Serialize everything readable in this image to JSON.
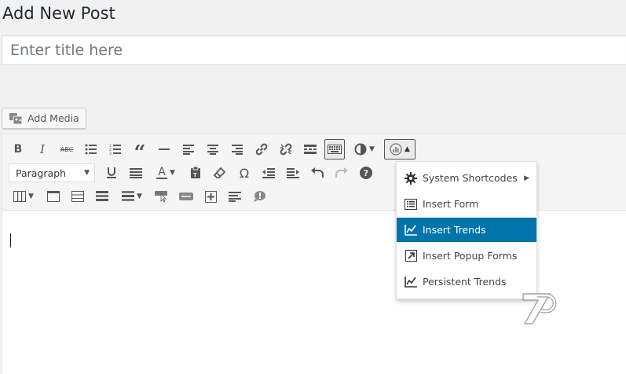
{
  "page": {
    "title": "Add New Post"
  },
  "title_field": {
    "placeholder": "Enter title here",
    "value": ""
  },
  "media": {
    "add_label": "Add Media"
  },
  "toolbar": {
    "row1": [
      {
        "name": "bold-button",
        "glyph": "B"
      },
      {
        "name": "italic-button",
        "glyph": "I"
      },
      {
        "name": "strikethrough-button",
        "glyph": "ABC"
      },
      {
        "name": "bulleted-list-button"
      },
      {
        "name": "numbered-list-button"
      },
      {
        "name": "blockquote-button",
        "glyph": "“"
      },
      {
        "name": "horizontal-line-button"
      },
      {
        "name": "align-left-button"
      },
      {
        "name": "align-center-button"
      },
      {
        "name": "align-right-button"
      },
      {
        "name": "insert-link-button"
      },
      {
        "name": "remove-link-button"
      },
      {
        "name": "read-more-button"
      },
      {
        "name": "toolbar-toggle-button"
      }
    ],
    "format_select": {
      "value": "Paragraph"
    },
    "text_color_glyph": "A",
    "special_char_glyph": "Ω",
    "help_glyph": "?"
  },
  "dropdown": {
    "items": [
      {
        "label": "System Shortcodes",
        "icon": "gear-icon",
        "has_submenu": true
      },
      {
        "label": "Insert Form",
        "icon": "form-icon"
      },
      {
        "label": "Insert Trends",
        "icon": "trend-chart-icon",
        "selected": true
      },
      {
        "label": "Insert Popup Forms",
        "icon": "popup-icon"
      },
      {
        "label": "Persistent Trends",
        "icon": "trend-chart-icon"
      }
    ]
  },
  "colors": {
    "accent": "#0073aa",
    "toolbar_bg": "#f5f5f5",
    "page_bg": "#f1f1f1",
    "icon": "#555555"
  }
}
